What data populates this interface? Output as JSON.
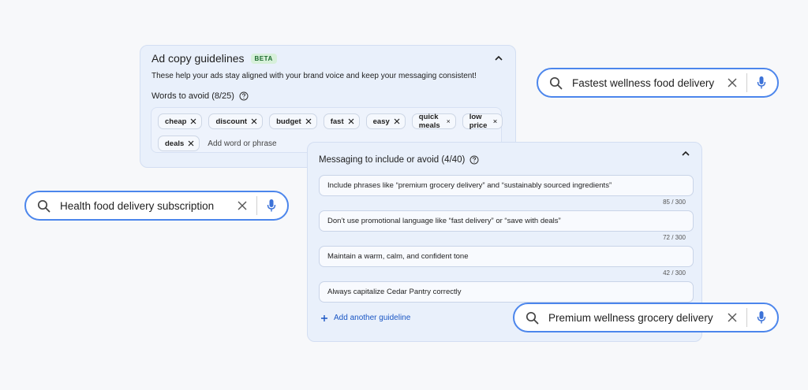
{
  "guidelines": {
    "title": "Ad copy guidelines",
    "badge": "BETA",
    "description": "These help your ads stay aligned with your brand voice and keep your messaging consistent!",
    "words_title": "Words to avoid (8/25)",
    "chips_row1": [
      "cheap",
      "discount",
      "budget",
      "fast",
      "easy",
      "quick meals",
      "low price"
    ],
    "chips_row2": [
      "deals"
    ],
    "add_placeholder": "Add word or phrase"
  },
  "messaging": {
    "title": "Messaging to include or avoid (4/40)",
    "items": [
      {
        "text": "Include phrases like “premium grocery delivery” and “sustainably sourced ingredients”",
        "count": "85 / 300"
      },
      {
        "text": "Don’t use promotional language like “fast delivery” or “save with deals”",
        "count": "72 / 300"
      },
      {
        "text": "Maintain a warm, calm, and confident tone",
        "count": "42 / 300"
      },
      {
        "text": "Always capitalize Cedar Pantry correctly",
        "count": ""
      }
    ],
    "add_label": "Add another guideline"
  },
  "searches": [
    {
      "query": "Fastest wellness food delivery"
    },
    {
      "query": "Health food delivery subscription"
    },
    {
      "query": "Premium wellness grocery delivery"
    }
  ],
  "icons": {
    "search": "search-icon",
    "clear": "close-icon",
    "mic": "microphone-icon",
    "collapse": "chevron-up-icon",
    "help": "help-circle-icon",
    "remove": "close-icon",
    "add": "plus-icon"
  },
  "colors": {
    "accent": "#4c86ec",
    "link": "#1a56c4",
    "panel": "#e9f0fb",
    "badge_bg": "#d7f0da",
    "badge_text": "#1b6b2e"
  }
}
